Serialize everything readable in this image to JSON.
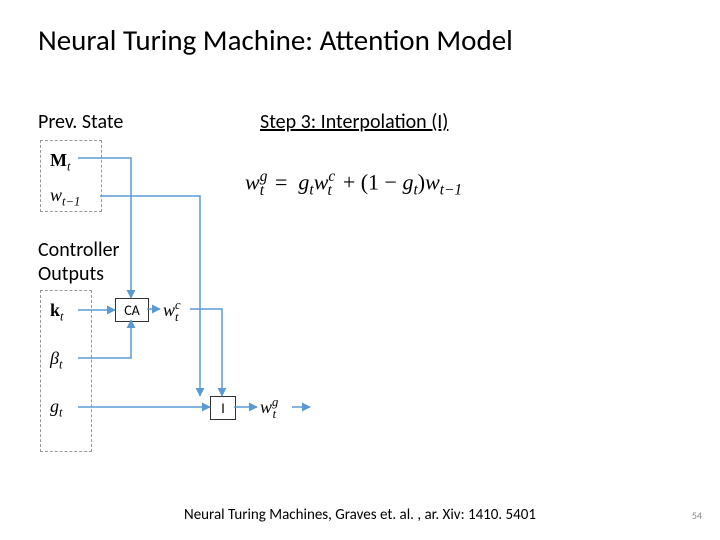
{
  "title": "Neural Turing Machine: Attention Model",
  "labels": {
    "prev_state": "Prev. State",
    "controller_outputs": "Controller\nOutputs",
    "step_title": "Step 3: Interpolation (I)"
  },
  "prev_state_syms": {
    "M_t": "M_t (bold)",
    "w_tm1": "w_{t-1}"
  },
  "controller_syms": {
    "k_t": "k_t (bold)",
    "beta_t": "β_t",
    "g_t": "g_t"
  },
  "boxes": {
    "CA": "CA",
    "I": "I"
  },
  "intermediate": {
    "w_c": "w_t^c",
    "w_g": "w_t^g"
  },
  "equation_plain": "w_t^g = g_t w_t^c + (1 - g_t) w_{t-1}",
  "citation": "Neural Turing Machines, Graves et. al. , ar. Xiv: 1410. 5401",
  "page_number": "54",
  "chart_data": {
    "type": "diagram",
    "nodes": [
      {
        "id": "M_t",
        "group": "prev_state"
      },
      {
        "id": "w_{t-1}",
        "group": "prev_state"
      },
      {
        "id": "k_t",
        "group": "controller_outputs"
      },
      {
        "id": "beta_t",
        "group": "controller_outputs"
      },
      {
        "id": "g_t",
        "group": "controller_outputs"
      },
      {
        "id": "CA",
        "group": "op",
        "label": "CA"
      },
      {
        "id": "w_t^c",
        "group": "intermediate"
      },
      {
        "id": "I",
        "group": "op",
        "label": "I"
      },
      {
        "id": "w_t^g",
        "group": "output"
      }
    ],
    "edges": [
      {
        "from": "M_t",
        "to": "CA"
      },
      {
        "from": "k_t",
        "to": "CA"
      },
      {
        "from": "beta_t",
        "to": "CA"
      },
      {
        "from": "CA",
        "to": "w_t^c"
      },
      {
        "from": "w_t^c",
        "to": "I"
      },
      {
        "from": "g_t",
        "to": "I"
      },
      {
        "from": "w_{t-1}",
        "to": "I"
      },
      {
        "from": "I",
        "to": "w_t^g"
      }
    ],
    "step": 3,
    "step_name": "Interpolation",
    "equation": "w_t^g = g_t * w_t^c + (1 - g_t) * w_{t-1}"
  }
}
